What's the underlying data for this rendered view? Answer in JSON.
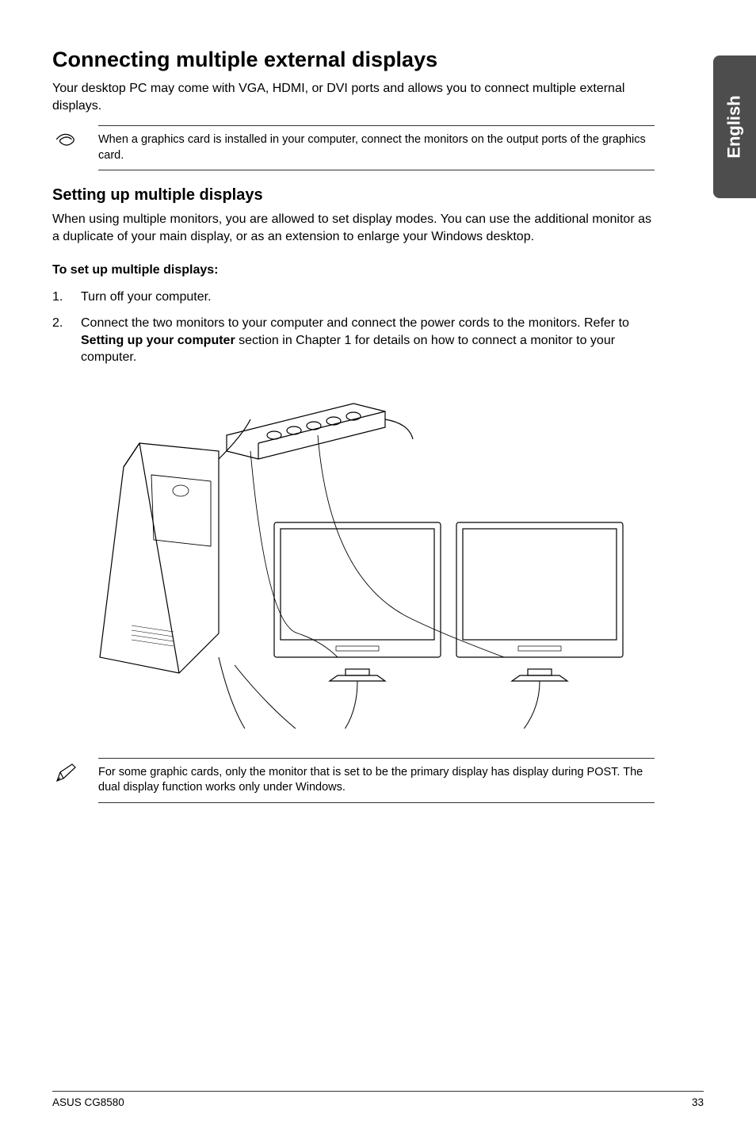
{
  "side_tab": "English",
  "heading": "Connecting multiple external displays",
  "intro": "Your desktop PC may come with VGA, HDMI, or DVI ports and allows you to connect multiple external displays.",
  "note1": "When a graphics card is installed in your computer, connect the monitors on the output ports of the graphics card.",
  "subheading": "Setting up multiple displays",
  "sub_intro": "When using multiple monitors, you are allowed to set display modes. You can use the additional monitor as a duplicate of your main display, or as an extension to enlarge your Windows desktop.",
  "list_heading": "To set up multiple displays:",
  "steps": {
    "s1": "Turn off your computer.",
    "s2_pre": "Connect the two monitors to your computer and connect the power cords to the monitors. Refer to ",
    "s2_bold": "Setting up your computer",
    "s2_post": " section in Chapter 1 for details on how to connect a monitor to your computer."
  },
  "note2": "For some graphic cards, only the monitor that is set to be the primary display has display during POST. The dual display function works only under Windows.",
  "footer_left": "ASUS CG8580",
  "footer_right": "33"
}
